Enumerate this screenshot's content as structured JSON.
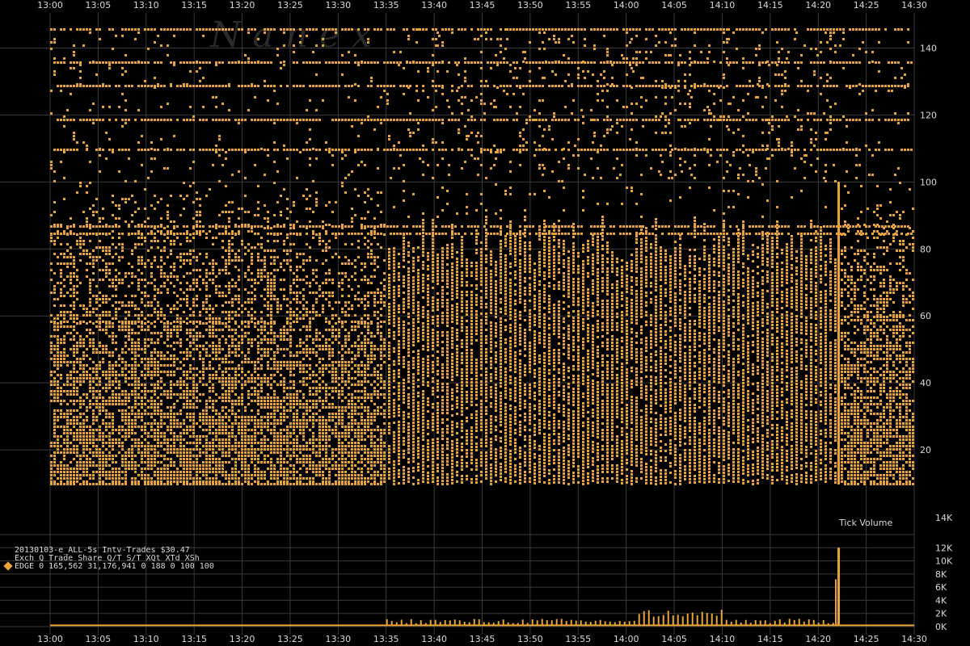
{
  "chart_data": [
    {
      "type": "scatter",
      "title": "",
      "x": [
        "13:00",
        "13:05",
        "13:10",
        "13:15",
        "13:20",
        "13:25",
        "13:30",
        "13:35",
        "13:40",
        "13:45",
        "13:50",
        "13:55",
        "14:00",
        "14:05",
        "14:10",
        "14:15",
        "14:20",
        "14:25",
        "14:30"
      ],
      "xlabel": "",
      "ylabel": "",
      "ylim": [
        0,
        150
      ],
      "yticks": [
        "140",
        "120",
        "100",
        "80",
        "60",
        "40",
        "20"
      ],
      "grid": true,
      "series": [
        {
          "name": "",
          "color": "#e8a33a",
          "bands": [
            {
              "from": "13:00",
              "to": "13:35",
              "dense_price_range": [
                10,
                58
              ],
              "scattered_price_range": [
                58,
                100
              ]
            },
            {
              "from": "13:35",
              "to": "14:22",
              "columns_price_range": [
                10,
                90
              ],
              "scattered_price_range": [
                90,
                146
              ]
            },
            {
              "from": "14:22",
              "to": "14:30",
              "dense_price_range": [
                10,
                60
              ],
              "scattered_price_range": [
                60,
                100
              ]
            }
          ],
          "persistent_price_levels": [
            146,
            136,
            129,
            119,
            110,
            87,
            85
          ]
        }
      ]
    },
    {
      "type": "bar",
      "title": "Tick Volume",
      "x_range": [
        "13:00",
        "14:30"
      ],
      "yticks": [
        "14K",
        "12K",
        "10K",
        "8K",
        "6K",
        "4K",
        "2K",
        "0K"
      ],
      "ylim": [
        0,
        14000
      ],
      "color": "#e8a33a",
      "baseline": 200,
      "activity_windows": [
        {
          "from": "13:35",
          "to": "14:22",
          "peak_values": [
            1900,
            1600,
            1700,
            1500
          ]
        },
        {
          "time": "14:22",
          "value": 12000
        }
      ]
    }
  ],
  "info": {
    "line1": "20130103-e_ALL-5s Intv-Trades $30.47",
    "line2": "Exch Q   Trade      Share  Q/T   S/T  XQt XTd XSh",
    "line3": "EDGE 0 165,562 31,176,941    0   188   0 100 100"
  },
  "watermark": "N  a  n  e  x",
  "colors": {
    "accent": "#e8a33a",
    "grid": "#3a3a3a",
    "text": "#d9d9d9",
    "background": "#000000"
  }
}
